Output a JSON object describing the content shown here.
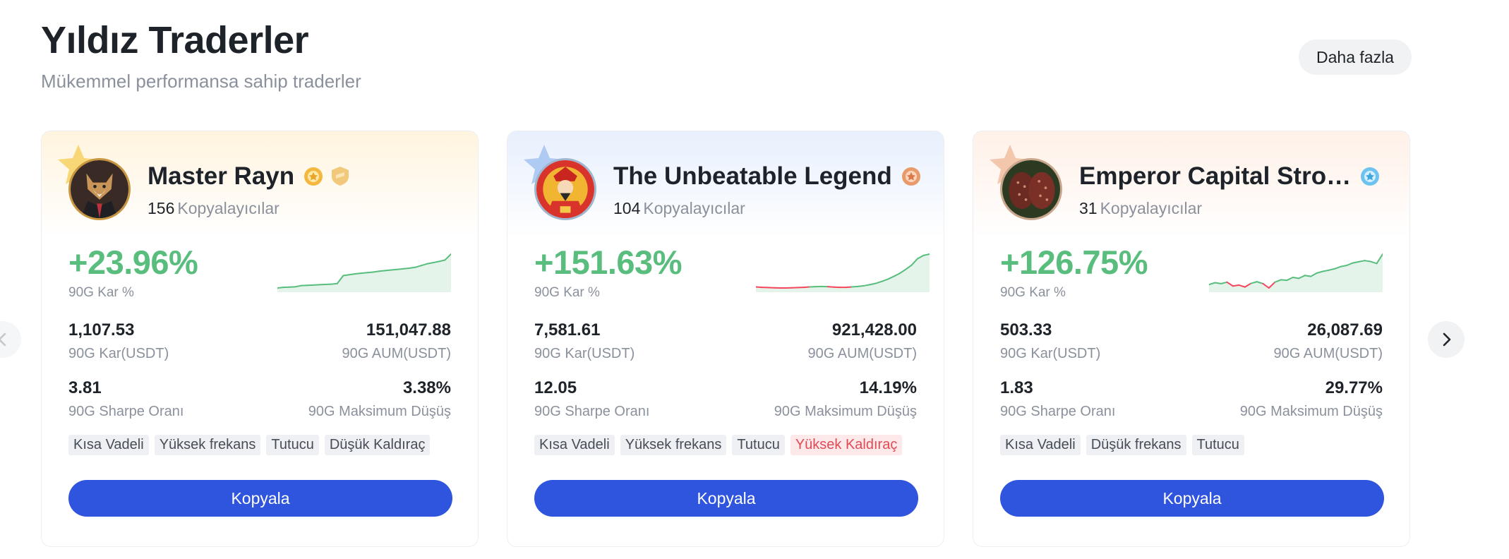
{
  "header": {
    "title": "Yıldız Traderler",
    "subtitle": "Mükemmel performansa sahip traderler",
    "more_label": "Daha fazla"
  },
  "nav": {
    "prev_icon": "chevron-left-icon",
    "next_icon": "chevron-right-icon"
  },
  "colors": {
    "positive": "#58bd7d",
    "negative": "#f6465d",
    "button": "#2f54dd"
  },
  "cards": [
    {
      "name": "Master Rayn",
      "followers": "156",
      "followers_label": "Kopyalayıcılar",
      "badges": [
        "gold-medal-icon",
        "gold-shield-icon"
      ],
      "roi": "+23.96%",
      "roi_label": "90G Kar %",
      "profit": "1,107.53",
      "profit_label": "90G Kar(USDT)",
      "aum": "151,047.88",
      "aum_label": "90G AUM(USDT)",
      "sharpe": "3.81",
      "sharpe_label": "90G Sharpe Oranı",
      "mdd": "3.38%",
      "mdd_label": "90G Maksimum Düşüş",
      "tags": [
        "Kısa Vadeli",
        "Yüksek frekans",
        "Tutucu",
        "Düşük Kaldıraç"
      ],
      "copy_label": "Kopyala",
      "sparkline": [
        0.0,
        0.2,
        0.3,
        0.4,
        0.8,
        0.9,
        1.0,
        1.1,
        1.2,
        1.3,
        1.5,
        4.2,
        4.5,
        4.8,
        5.0,
        5.2,
        5.4,
        5.7,
        5.9,
        6.1,
        6.3,
        6.5,
        6.7,
        7.0,
        7.6,
        8.2,
        8.6,
        9.0,
        9.5,
        11.5
      ]
    },
    {
      "name": "The Unbeatable Legend",
      "followers": "104",
      "followers_label": "Kopyalayıcılar",
      "badges": [
        "bronze-medal-icon"
      ],
      "roi": "+151.63%",
      "roi_label": "90G Kar %",
      "profit": "7,581.61",
      "profit_label": "90G Kar(USDT)",
      "aum": "921,428.00",
      "aum_label": "90G AUM(USDT)",
      "sharpe": "12.05",
      "sharpe_label": "90G Sharpe Oranı",
      "mdd": "14.19%",
      "mdd_label": "90G Maksimum Düşüş",
      "tags": [
        "Kısa Vadeli",
        "Yüksek frekans",
        "Tutucu",
        "Yüksek Kaldıraç"
      ],
      "copy_label": "Kopyala",
      "sparkline": [
        0,
        -2,
        -3,
        -4,
        -5,
        -5,
        -4,
        -3,
        -2,
        0,
        1,
        2,
        1,
        -1,
        -2,
        -2,
        0,
        2,
        5,
        10,
        16,
        25,
        35,
        48,
        62,
        80,
        100,
        130,
        145,
        151
      ]
    },
    {
      "name": "Emperor Capital Stro…",
      "followers": "31",
      "followers_label": "Kopyalayıcılar",
      "badges": [
        "blue-medal-icon"
      ],
      "roi": "+126.75%",
      "roi_label": "90G Kar %",
      "profit": "503.33",
      "profit_label": "90G Kar(USDT)",
      "aum": "26,087.69",
      "aum_label": "90G AUM(USDT)",
      "sharpe": "1.83",
      "sharpe_label": "90G Sharpe Oranı",
      "mdd": "29.77%",
      "mdd_label": "90G Maksimum Düşüş",
      "tags": [
        "Kısa Vadeli",
        "Düşük frekans",
        "Tutucu"
      ],
      "copy_label": "Kopyala",
      "sparkline": [
        0,
        8,
        4,
        10,
        -6,
        -2,
        -10,
        5,
        12,
        4,
        -14,
        10,
        20,
        18,
        30,
        26,
        38,
        34,
        48,
        55,
        60,
        66,
        75,
        80,
        90,
        95,
        100,
        96,
        88,
        127
      ]
    }
  ]
}
